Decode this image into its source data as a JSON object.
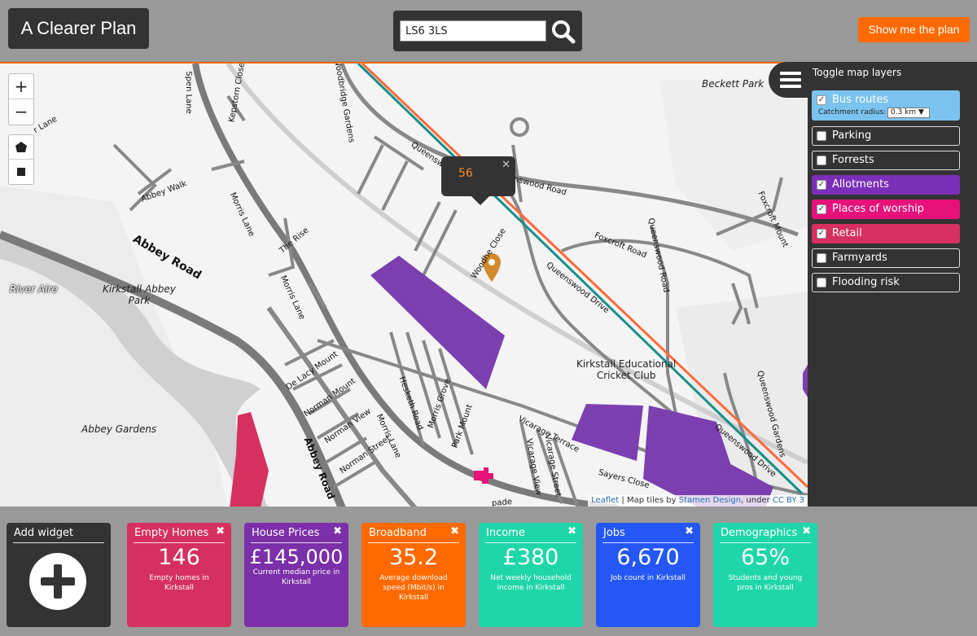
{
  "app": {
    "title": "A Clearer Plan"
  },
  "search": {
    "value": "LS6 3LS"
  },
  "header": {
    "cta_label": "Show me the plan"
  },
  "map": {
    "zoom_in": "+",
    "zoom_out": "−",
    "popup_value": "56",
    "popup_close": "✕",
    "places": {
      "beckett_park": "Beckett Park",
      "river_aire": "River Aire",
      "kirkstall_abbey_park": "Kirkstall Abbey\nPark",
      "abbey_gardens": "Abbey Gardens",
      "cricket_club": "Kirkstall Educational\nCricket Club"
    },
    "roads": {
      "abbey_road": "Abbey Road",
      "abbey_road_2": "Abbey Road",
      "abbey_walk": "Abbey Walk",
      "spen_lane": "Spen Lane",
      "kepstorn_close": "Kepstorn Close",
      "woodbridge_gardens": "Woodbridge Gardens",
      "queenswood": "Queenswood",
      "queenswood_road": "nswood Road",
      "woodhouse_close": "Woodhe Close",
      "queenswood_drive": "Queenswood Drive",
      "foxcroft_road": "Foxcroft Road",
      "foxcroft_mount": "Foxcroft Mount",
      "queenswood_road_2": "Queenswood Road",
      "morris_lane": "Morris Lane",
      "the_rise": "The Rise",
      "morris_lane_2": "Morris Lane",
      "de_lacy_mount": "De Lacy Mount",
      "norman_mount": "Norman Mount",
      "norman_view": "Norman View",
      "norman_street": "Norman Street",
      "morris_lane_3": "Morris Lane",
      "hesketh_road": "Hesketh Road",
      "morris_grove": "Morris Grove",
      "park_mount": "Park Mount",
      "vicarage_terrace": "Vicarage Terrace",
      "vicarage_view": "Vicarage View",
      "vicarage_street": "Vicarage Street",
      "sayers_close": "Sayers Close",
      "queenswood_gardens": "Queenswood Gardens",
      "queenswood_drive_2": "Queenswood Drive",
      "lane_nw": "r Lane",
      "spade": "pade"
    },
    "attribution": {
      "leaflet": "Leaflet",
      "sep": " | Map tiles by ",
      "stamen": "Stamen Design",
      "under": ", under ",
      "cc": "CC BY 3"
    }
  },
  "layers_panel": {
    "title": "Toggle map layers",
    "catchment_label": "Catchment radius:",
    "catchment_value": "0.3 km ▼",
    "items": [
      {
        "label": "Bus routes",
        "checked": true,
        "color": "#7ac3ef"
      },
      {
        "label": "Parking",
        "checked": false
      },
      {
        "label": "Forrests",
        "checked": false
      },
      {
        "label": "Allotments",
        "checked": true,
        "color": "#7b2fb8"
      },
      {
        "label": "Places of worship",
        "checked": true,
        "color": "#e6117a"
      },
      {
        "label": "Retail",
        "checked": true,
        "color": "#d63060"
      },
      {
        "label": "Farmyards",
        "checked": false
      },
      {
        "label": "Flooding risk",
        "checked": false
      }
    ]
  },
  "widgets": {
    "add": {
      "title": "Add widget"
    },
    "close_glyph": "✖",
    "items": [
      {
        "title": "Empty Homes",
        "value": "146",
        "desc": "Empty homes in\nKirkstall",
        "color": "#d63060"
      },
      {
        "title": "House Prices",
        "value": "£145,000",
        "desc": "Current median price in\nKirkstall",
        "color": "#7b2fa8"
      },
      {
        "title": "Broadband",
        "value": "35.2",
        "desc": "Average download\nspeed (Mbit/s) in\nKirkstall",
        "color": "#ff6a00"
      },
      {
        "title": "Income",
        "value": "£380",
        "desc": "Net weekly household\nincome in Kirkstall",
        "color": "#1fd6a8"
      },
      {
        "title": "Jobs",
        "value": "6,670",
        "desc": "Job count in Kirkstall",
        "color": "#2457f5"
      },
      {
        "title": "Demographics",
        "value": "65%",
        "desc": "Students and young\npros in Kirkstall",
        "color": "#1fd6a8"
      }
    ]
  }
}
